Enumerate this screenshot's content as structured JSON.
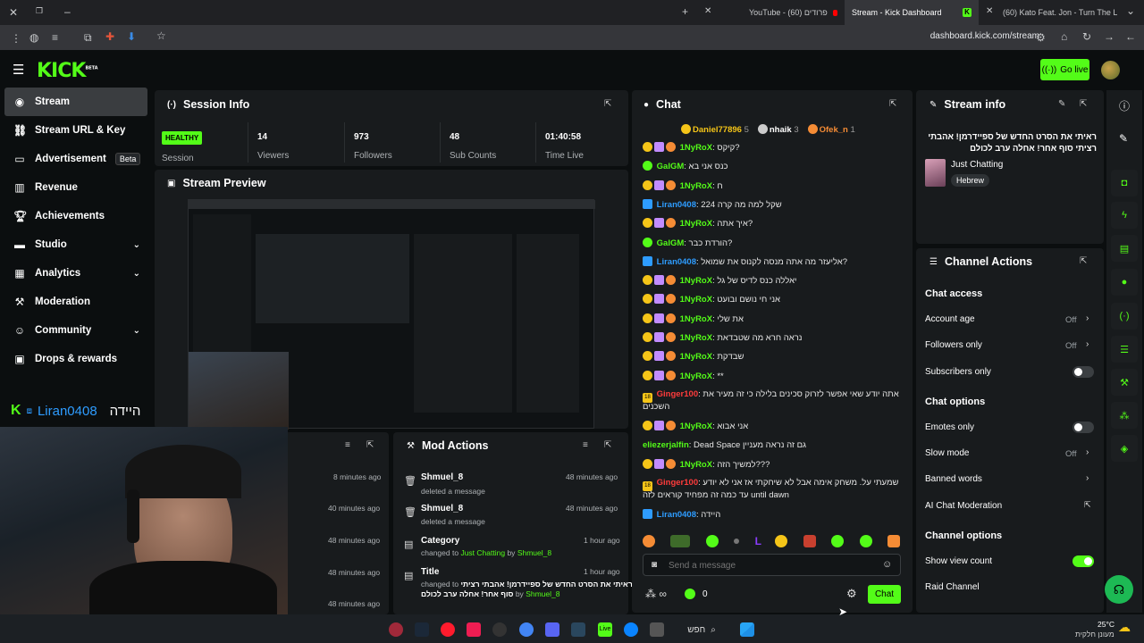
{
  "browser": {
    "tabs": [
      {
        "label": "YouTube - פרודים (60)"
      },
      {
        "label": "Stream - Kick Dashboard"
      },
      {
        "label": "(60) Kato Feat. Jon - Turn The L"
      }
    ],
    "url": "dashboard.kick.com/stream"
  },
  "header": {
    "logo": "KICK",
    "logo_tag": "BETA",
    "go_live": "Go live"
  },
  "sidebar": {
    "items": [
      {
        "label": "Stream",
        "icon": "broadcast-icon"
      },
      {
        "label": "Stream URL & Key",
        "icon": "link-icon"
      },
      {
        "label": "Advertisement",
        "icon": "ad-icon",
        "badge": "Beta"
      },
      {
        "label": "Revenue",
        "icon": "chart-icon"
      },
      {
        "label": "Achievements",
        "icon": "trophy-icon"
      },
      {
        "label": "Studio",
        "icon": "studio-icon"
      },
      {
        "label": "Analytics",
        "icon": "analytics-icon"
      },
      {
        "label": "Moderation",
        "icon": "hammer-icon"
      },
      {
        "label": "Community",
        "icon": "community-icon"
      },
      {
        "label": "Drops & rewards",
        "icon": "gift-icon"
      }
    ]
  },
  "overlay": {
    "channel": "Liran0408",
    "greeting": "היידה"
  },
  "session": {
    "title": "Session Info",
    "health": "HEALTHY",
    "session_label": "Session",
    "stats": [
      {
        "value": "14",
        "label": "Viewers"
      },
      {
        "value": "973",
        "label": "Followers"
      },
      {
        "value": "48",
        "label": "Sub Counts"
      },
      {
        "value": "01:40:58",
        "label": "Time Live"
      }
    ]
  },
  "preview": {
    "title": "Stream Preview"
  },
  "chat": {
    "title": "Chat",
    "top": [
      {
        "name": "Daniel77896",
        "count": "5"
      },
      {
        "name": "nhaik",
        "count": "3"
      },
      {
        "name": "Ofek_n",
        "count": "1"
      }
    ],
    "messages": [
      {
        "user": "1NyRoX",
        "text": "קיקס?",
        "color": "green"
      },
      {
        "user": "GalGM",
        "text": "כנס אני בא",
        "color": "green"
      },
      {
        "user": "1NyRoX",
        "text": "ח",
        "color": "green"
      },
      {
        "user": "Liran0408",
        "text": "שקל למה מה קרה 224",
        "color": "blue"
      },
      {
        "user": "1NyRoX",
        "text": "איך אתה?",
        "color": "green"
      },
      {
        "user": "GalGM",
        "text": "הורדת כבר?",
        "color": "green"
      },
      {
        "user": "Liran0408",
        "text": "אליעזר מה אתה מנסה לקנוס את שמואל?",
        "color": "blue"
      },
      {
        "user": "1NyRoX",
        "text": "יאללה כנס לדיס של גל",
        "color": "green"
      },
      {
        "user": "1NyRoX",
        "text": "אני חי נושם ובועט",
        "color": "green"
      },
      {
        "user": "1NyRoX",
        "text": "את שלי",
        "color": "green"
      },
      {
        "user": "1NyRoX",
        "text": "נראה חרא מה שטבדאת",
        "color": "green"
      },
      {
        "user": "1NyRoX",
        "text": "שבדקת",
        "color": "green"
      },
      {
        "user": "1NyRoX",
        "text": "**",
        "color": "green"
      },
      {
        "user": "Ginger100",
        "text": "אתה יודע שאי אפשר לזרוק סכינים בלילה כי זה מעיר את",
        "text2": "השכנים",
        "color": "red"
      },
      {
        "user": "1NyRoX",
        "text": "אני אבוא",
        "color": "green"
      },
      {
        "user": "eliezerjalfin",
        "text": "Dead Space גם זה נראה מעניין",
        "color": "green"
      },
      {
        "user": "1NyRoX",
        "text": "למשיך הזה???",
        "color": "green"
      },
      {
        "user": "Ginger100",
        "text": "שמעתי על. משחק אימה אבל לא שיחקתי אז אני לא יודע",
        "text2": "עד כמה זה מפחיד קוראים לזה until dawn",
        "color": "red"
      },
      {
        "user": "Liran0408",
        "text": "היידה",
        "color": "blue"
      }
    ],
    "placeholder": "Send a message",
    "points": "0",
    "chat_button": "Chat"
  },
  "stream_info": {
    "title": "Stream info",
    "stream_title": "ראיתי את הסרט החדש של ספיידרמן! אהבתי רציתי סוף אחר! אחלה ערב לכולם",
    "category": "Just Chatting",
    "tag": "Hebrew"
  },
  "channel_actions": {
    "title": "Channel Actions",
    "chat_access": "Chat access",
    "account_age": {
      "label": "Account age",
      "value": "Off"
    },
    "followers_only": {
      "label": "Followers only",
      "value": "Off"
    },
    "subscribers_only": {
      "label": "Subscribers only"
    },
    "chat_options": "Chat options",
    "emotes_only": {
      "label": "Emotes only"
    },
    "slow_mode": {
      "label": "Slow mode",
      "value": "Off"
    },
    "banned_words": {
      "label": "Banned words"
    },
    "ai_moderation": {
      "label": "AI Chat Moderation"
    },
    "channel_options": "Channel options",
    "show_view_count": {
      "label": "Show view count"
    },
    "raid_channel": {
      "label": "Raid Channel"
    }
  },
  "mod_actions": {
    "title": "Mod Actions",
    "items": [
      {
        "title": "Shmuel_8",
        "sub": "deleted a message",
        "time": "48 minutes ago",
        "icon": "trash-icon"
      },
      {
        "title": "Shmuel_8",
        "sub": "deleted a message",
        "time": "48 minutes ago",
        "icon": "trash-icon"
      },
      {
        "title": "Category",
        "sub_prefix": "changed to",
        "sub_value": "Just Chatting",
        "sub_by": "by",
        "sub_user": "Shmuel_8",
        "time": "1 hour ago",
        "icon": "category-icon"
      },
      {
        "title": "Title",
        "sub_prefix": "changed to",
        "sub_value": "ראיתי את הסרט החדש של ספיידרמן! אהבתי רציתי",
        "sub_value2": "סוף אחר! אחלה ערב לכולם",
        "sub_by": "by",
        "sub_user": "Shmuel_8",
        "time": "1 hour ago",
        "icon": "title-icon"
      }
    ]
  },
  "left_feed": {
    "times": [
      "8 minutes ago",
      "40 minutes ago",
      "48 minutes ago",
      "48 minutes ago",
      "48 minutes ago"
    ]
  },
  "taskbar": {
    "search": "חפש",
    "weather_temp": "25°C",
    "weather_desc": "מעונן חלקית"
  },
  "colors": {
    "accent": "#53fc18",
    "panel": "#181b1d",
    "background": "#0b0e0f"
  }
}
